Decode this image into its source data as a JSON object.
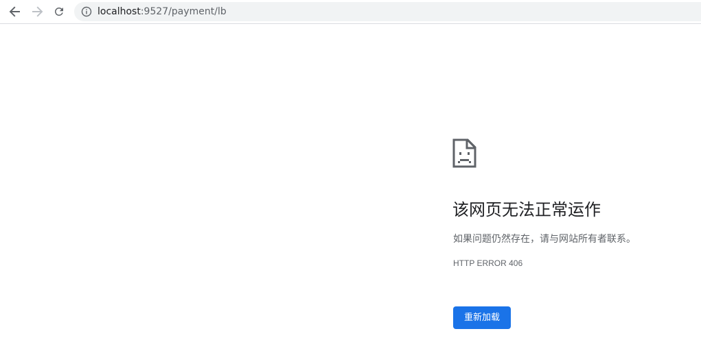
{
  "browser": {
    "address_bar": {
      "host": "localhost",
      "path": ":9527/payment/lb"
    },
    "icons": {
      "back": "arrow-left-icon",
      "forward": "arrow-right-icon",
      "reload": "reload-icon",
      "site_info": "info-circle-icon"
    },
    "forward_enabled": false
  },
  "error_page": {
    "icon": "sad-page-icon",
    "title": "该网页无法正常运作",
    "message": "如果问题仍然存在，请与网站所有者联系。",
    "error_code": "HTTP ERROR 406",
    "reload_label": "重新加载",
    "accent_color": "#1a73e8"
  }
}
